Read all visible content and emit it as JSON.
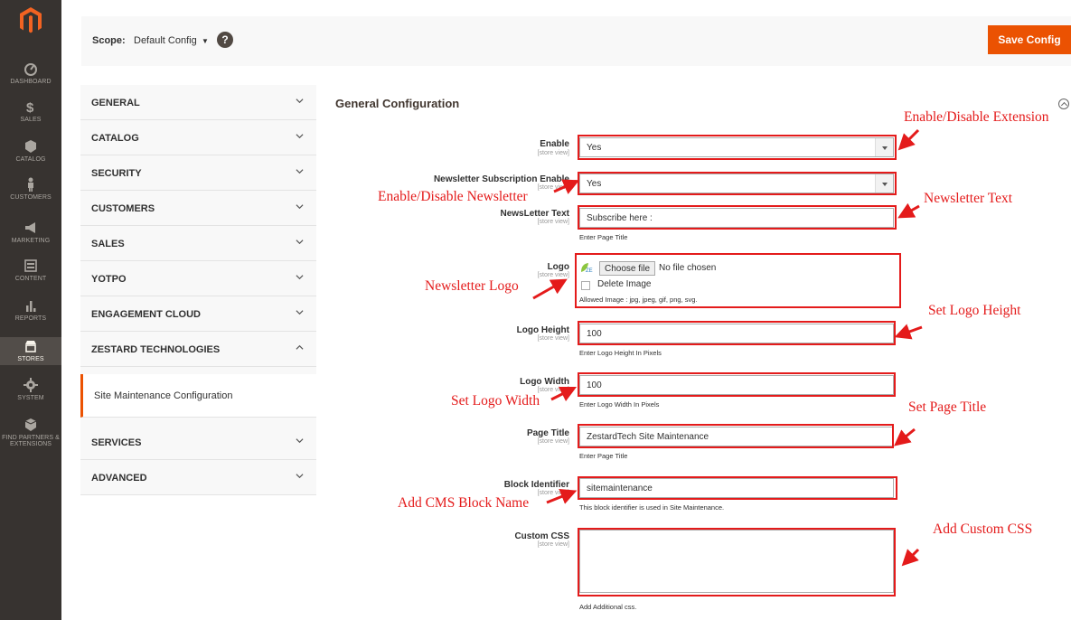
{
  "sidebar": {
    "items": [
      {
        "label": "DASHBOARD",
        "icon": "dashboard-icon"
      },
      {
        "label": "SALES",
        "icon": "dollar-icon"
      },
      {
        "label": "CATALOG",
        "icon": "cube-icon"
      },
      {
        "label": "CUSTOMERS",
        "icon": "person-icon"
      },
      {
        "label": "MARKETING",
        "icon": "megaphone-icon"
      },
      {
        "label": "CONTENT",
        "icon": "content-icon"
      },
      {
        "label": "REPORTS",
        "icon": "bar-chart-icon"
      },
      {
        "label": "STORES",
        "icon": "store-icon"
      },
      {
        "label": "SYSTEM",
        "icon": "gear-icon"
      },
      {
        "label": "FIND PARTNERS & EXTENSIONS",
        "icon": "box-icon"
      }
    ],
    "active": "STORES"
  },
  "header": {
    "scope_label": "Scope:",
    "scope_value": "Default Config",
    "help": "?",
    "save_label": "Save Config"
  },
  "tabs": {
    "items": [
      "GENERAL",
      "CATALOG",
      "SECURITY",
      "CUSTOMERS",
      "SALES",
      "YOTPO",
      "ENGAGEMENT CLOUD",
      "ZESTARD TECHNOLOGIES"
    ],
    "sub_item": "Site Maintenance Configuration",
    "after": [
      "SERVICES",
      "ADVANCED"
    ]
  },
  "main": {
    "section_title": "General Configuration",
    "scope_hint": "[store view]",
    "fields": {
      "enable": {
        "label": "Enable",
        "value": "Yes"
      },
      "newsletter_enable": {
        "label": "Newsletter Subscription Enable",
        "value": "Yes"
      },
      "newsletter_text": {
        "label": "NewsLetter Text",
        "value": "Subscribe here  :",
        "note": "Enter Page Title"
      },
      "logo": {
        "label": "Logo",
        "choose": "Choose file",
        "nofile": "No file chosen",
        "delete": "Delete Image",
        "note": "Allowed Image : jpg, jpeg, gif, png, svg."
      },
      "logo_height": {
        "label": "Logo Height",
        "value": "100",
        "note": "Enter Logo Height In Pixels"
      },
      "logo_width": {
        "label": "Logo Width",
        "value": "100",
        "note": "Enter Logo Width In Pixels"
      },
      "page_title": {
        "label": "Page Title",
        "value": "ZestardTech Site Maintenance",
        "note": "Enter Page Title"
      },
      "block_identifier": {
        "label": "Block Identifier",
        "value": "sitemaintenance",
        "note": "This block identifier is used in Site Maintenance."
      },
      "custom_css": {
        "label": "Custom CSS",
        "value": "",
        "note": "Add Additional css."
      }
    }
  },
  "annotations": {
    "enable_ext": "Enable/Disable Extension",
    "enable_news": "Enable/Disable Newsletter",
    "news_text": "Newsletter Text",
    "news_logo": "Newsletter Logo",
    "logo_height": "Set Logo Height",
    "logo_width": "Set Logo Width",
    "page_title": "Set Page Title",
    "cms_block": "Add CMS Block Name",
    "custom_css": "Add Custom CSS"
  },
  "colors": {
    "accent": "#eb5202",
    "annotation": "#e41b1b",
    "sidebar": "#373330"
  }
}
